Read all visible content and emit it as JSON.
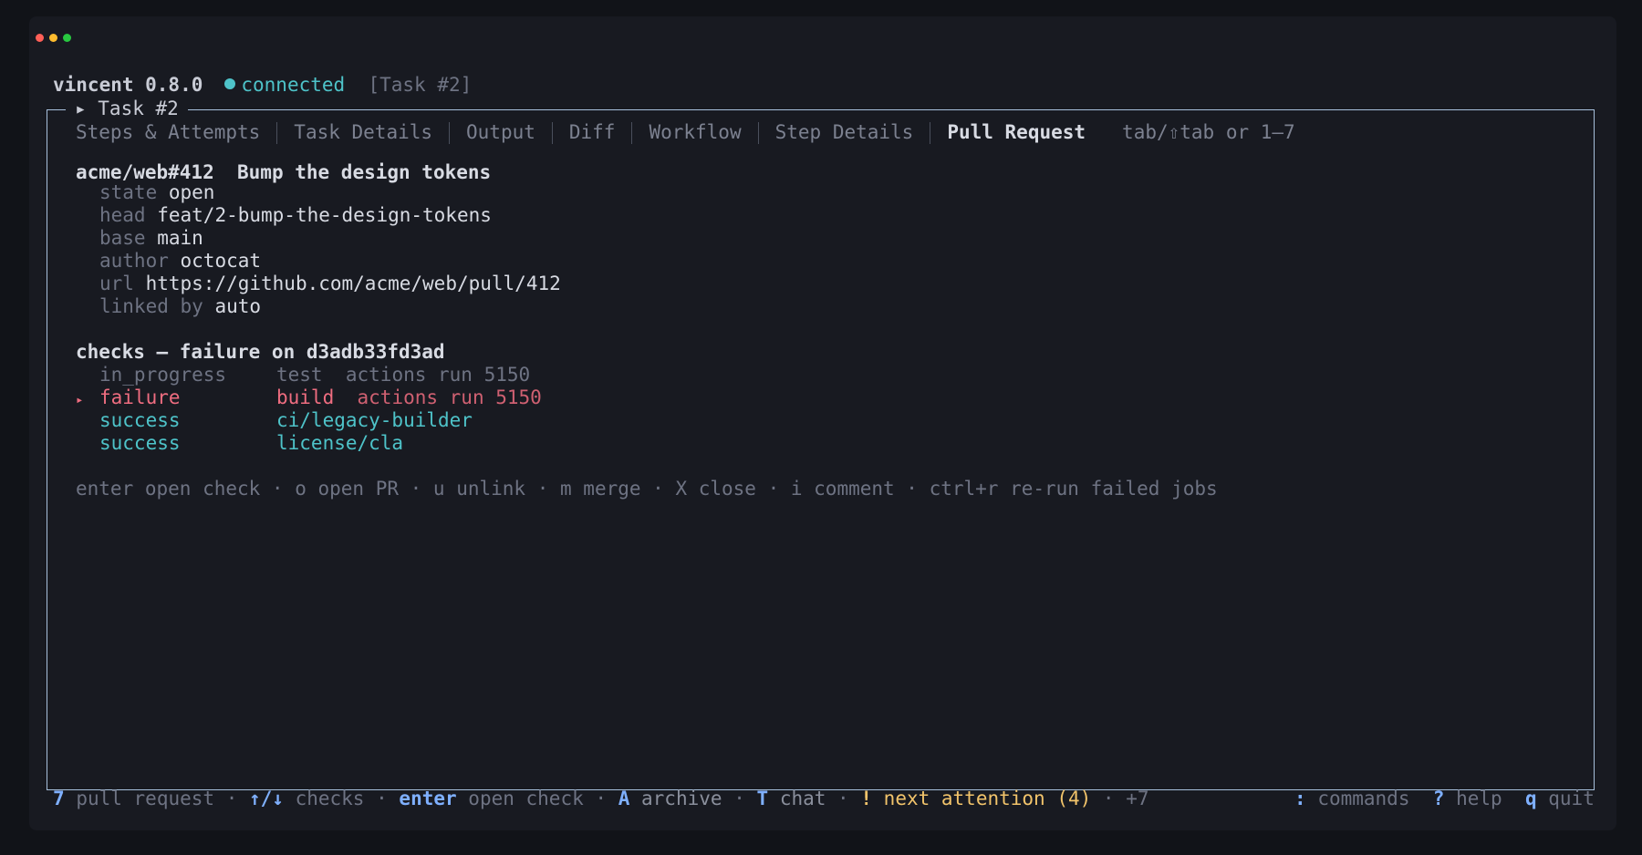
{
  "window": {
    "colors": {
      "close": "#ff5f57",
      "minimize": "#febc2e",
      "zoom": "#28c840"
    }
  },
  "header": {
    "app_name": "vincent 0.8.0",
    "status": "connected",
    "task_ref": "[Task #2]"
  },
  "panel": {
    "title": "▸ Task #2",
    "tabs": [
      {
        "label": "Steps & Attempts"
      },
      {
        "label": "Task Details"
      },
      {
        "label": "Output"
      },
      {
        "label": "Diff"
      },
      {
        "label": "Workflow"
      },
      {
        "label": "Step Details"
      },
      {
        "label": "Pull Request",
        "active": true
      }
    ],
    "tab_hint": "tab/⇧tab or 1–7"
  },
  "pr": {
    "ref": "acme/web#412",
    "title": "Bump the design tokens",
    "fields": [
      {
        "key": "state",
        "value": "open"
      },
      {
        "key": "head",
        "value": "feat/2-bump-the-design-tokens"
      },
      {
        "key": "base",
        "value": "main"
      },
      {
        "key": "author",
        "value": "octocat"
      },
      {
        "key": "url",
        "value": "https://github.com/acme/web/pull/412"
      },
      {
        "key": "linked by",
        "value": "auto"
      }
    ]
  },
  "checks": {
    "heading": "checks — failure on d3adb33fd3ad",
    "items": [
      {
        "status": "in_progress",
        "name": "test",
        "detail": "actions run 5150",
        "selected": false
      },
      {
        "status": "failure",
        "name": "build",
        "detail": "actions run 5150",
        "selected": true
      },
      {
        "status": "success",
        "name": "ci/legacy-builder",
        "detail": "",
        "selected": false
      },
      {
        "status": "success",
        "name": "license/cla",
        "detail": "",
        "selected": false
      }
    ],
    "selected_marker": "▸",
    "hints": "enter open check · o open PR · u unlink · m merge · X close · i comment · ctrl+r re-run failed jobs"
  },
  "footer": {
    "k1": "7",
    "l1": "pull request",
    "k2": "↑/↓",
    "l2": "checks",
    "k3": "enter",
    "l3": "open check",
    "k4": "A",
    "l4": "archive",
    "k5": "T",
    "l5": "chat",
    "k6": "!",
    "l6": "next attention (4)",
    "more": "+7",
    "k7": ":",
    "l7": "commands",
    "k8": "?",
    "l8": "help",
    "k9": "q",
    "l9": "quit",
    "dot": "·"
  }
}
